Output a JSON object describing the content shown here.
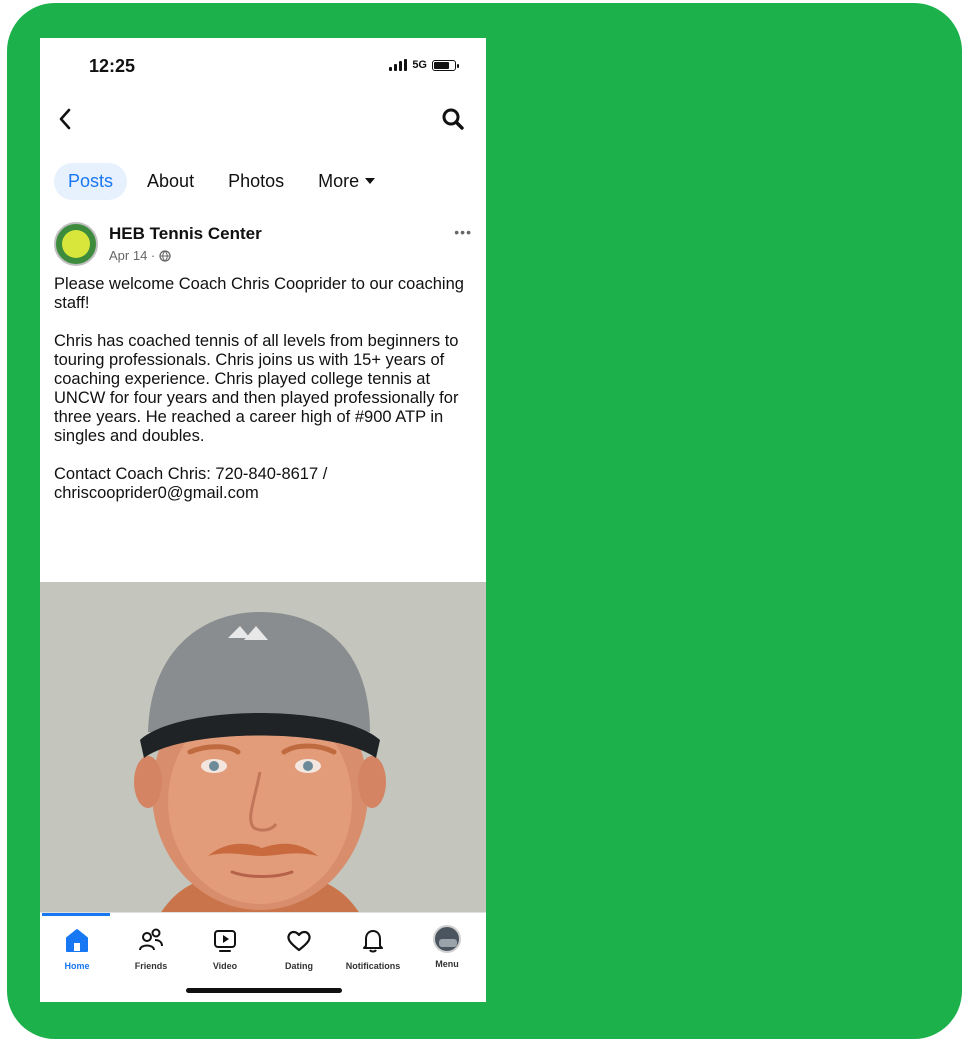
{
  "status_bar": {
    "time": "12:25",
    "network": "5G",
    "battery_level": 0.75
  },
  "nav": {
    "back_icon": "chevron-left-icon",
    "search_icon": "search-icon"
  },
  "tabs": [
    {
      "label": "Posts",
      "active": true
    },
    {
      "label": "About",
      "active": false
    },
    {
      "label": "Photos",
      "active": false
    },
    {
      "label": "More",
      "active": false
    }
  ],
  "post": {
    "page_name": "HEB Tennis Center",
    "date": "Apr 14 ·",
    "paragraphs": [
      "Please welcome Coach Chris Cooprider to our coaching staff!",
      "Chris has coached tennis of all levels from beginners to touring professionals. Chris joins us with 15+ years of coaching experience. Chris played college tennis at UNCW for four years and then played professionally for three years. He reached a career high of #900 ATP in singles and doubles.",
      "Contact Coach Chris: 720-840-8617 / chriscooprider0@gmail.com"
    ]
  },
  "bottom_nav": [
    {
      "label": "Home",
      "icon": "home-icon",
      "active": true
    },
    {
      "label": "Friends",
      "icon": "friends-icon",
      "active": false
    },
    {
      "label": "Video",
      "icon": "video-icon",
      "active": false
    },
    {
      "label": "Dating",
      "icon": "heart-icon",
      "active": false
    },
    {
      "label": "Notifications",
      "icon": "bell-icon",
      "active": false
    },
    {
      "label": "Menu",
      "icon": "menu-avatar-icon",
      "active": false
    }
  ],
  "colors": {
    "frame": "#1db14b",
    "accent": "#1877f2"
  }
}
